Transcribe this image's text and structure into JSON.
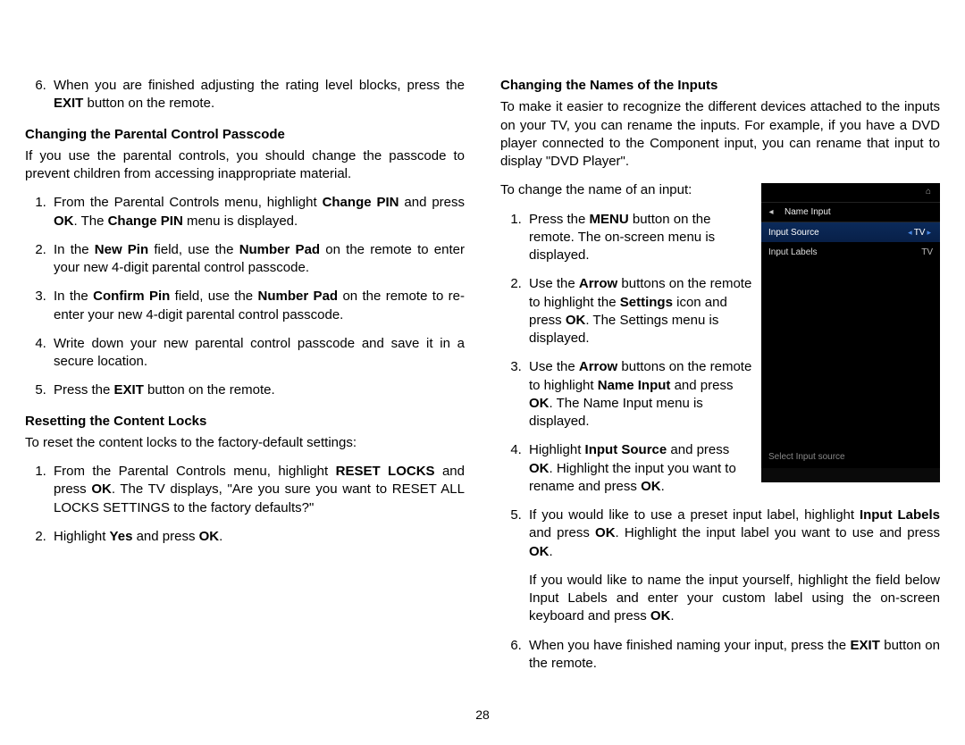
{
  "page_number": "28",
  "left": {
    "step6_pre": "When you are finished adjusting the rating level blocks, press the ",
    "step6_bold": "EXIT",
    "step6_post": " button on the remote.",
    "passcode_heading": "Changing the Parental Control Passcode",
    "passcode_intro": "If you use the parental controls, you should change the passcode to prevent children from accessing inappropriate material.",
    "pass_steps": {
      "s1_a": "From the Parental Controls menu, highlight ",
      "s1_b": "Change PIN",
      "s1_c": " and press ",
      "s1_d": "OK",
      "s1_e": ". The ",
      "s1_f": "Change PIN",
      "s1_g": " menu is displayed.",
      "s2_a": "In the ",
      "s2_b": "New Pin",
      "s2_c": " field, use the ",
      "s2_d": "Number Pad",
      "s2_e": " on the remote to enter your new 4-digit parental control passcode.",
      "s3_a": "In the ",
      "s3_b": "Confirm Pin",
      "s3_c": " field, use the ",
      "s3_d": "Number Pad",
      "s3_e": " on the remote to re-enter your new 4-digit parental control passcode.",
      "s4": "Write down your new parental control passcode and save it in a secure location.",
      "s5_a": "Press the ",
      "s5_b": "EXIT",
      "s5_c": " button on the remote."
    },
    "reset_heading": "Resetting the Content Locks",
    "reset_intro": "To reset the content locks to the factory-default settings:",
    "reset_steps": {
      "s1_a": "From the Parental Controls menu, highlight ",
      "s1_b": "RESET LOCKS",
      "s1_c": " and press ",
      "s1_d": "OK",
      "s1_e": ". The TV displays, \"Are you sure you want to RESET ALL LOCKS SETTINGS to the factory defaults?\"",
      "s2_a": "Highlight ",
      "s2_b": "Yes",
      "s2_c": " and press ",
      "s2_d": "OK",
      "s2_e": "."
    }
  },
  "right": {
    "inputs_heading": "Changing the Names of the Inputs",
    "inputs_intro": "To make it easier to recognize the different devices attached to the inputs on your TV, you can rename the inputs. For example, if you have a DVD player connected to the Component input, you can rename that input to display \"DVD Player\".",
    "inputs_lead": "To change the name of an input:",
    "steps": {
      "s1_a": "Press the ",
      "s1_b": "MENU",
      "s1_c": " button on the remote. The on-screen menu is displayed.",
      "s2_a": "Use the ",
      "s2_b": "Arrow",
      "s2_c": " buttons on the remote to highlight the ",
      "s2_d": "Settings",
      "s2_e": " icon and press ",
      "s2_f": "OK",
      "s2_g": ". The Settings menu is displayed.",
      "s3_a": "Use the ",
      "s3_b": "Arrow",
      "s3_c": " buttons on the remote to highlight ",
      "s3_d": "Name Input",
      "s3_e": " and press ",
      "s3_f": "OK",
      "s3_g": ". The Name Input menu is displayed.",
      "s4_a": "Highlight ",
      "s4_b": "Input Source",
      "s4_c": " and press ",
      "s4_d": "OK",
      "s4_e": ". Highlight the input you want to rename and press ",
      "s4_f": "OK",
      "s4_g": ".",
      "s5_a": "If you would like to use a preset input label, highlight ",
      "s5_b": "Input Labels",
      "s5_c": " and press ",
      "s5_d": "OK",
      "s5_e": ". Highlight the input label you want to use and press ",
      "s5_f": "OK",
      "s5_g": ".",
      "s5_follow_a": "If you would like to name the input yourself, highlight the field below Input Labels and enter your custom label using the on-screen keyboard and press ",
      "s5_follow_b": "OK",
      "s5_follow_c": ".",
      "s6_a": "When you have finished naming your input, press the ",
      "s6_b": "EXIT",
      "s6_c": " button on the remote."
    }
  },
  "tv_menu": {
    "title": "Name Input",
    "row1_label": "Input Source",
    "row1_value": "TV",
    "row2_label": "Input Labels",
    "row2_value": "TV",
    "hint": "Select Input source"
  }
}
